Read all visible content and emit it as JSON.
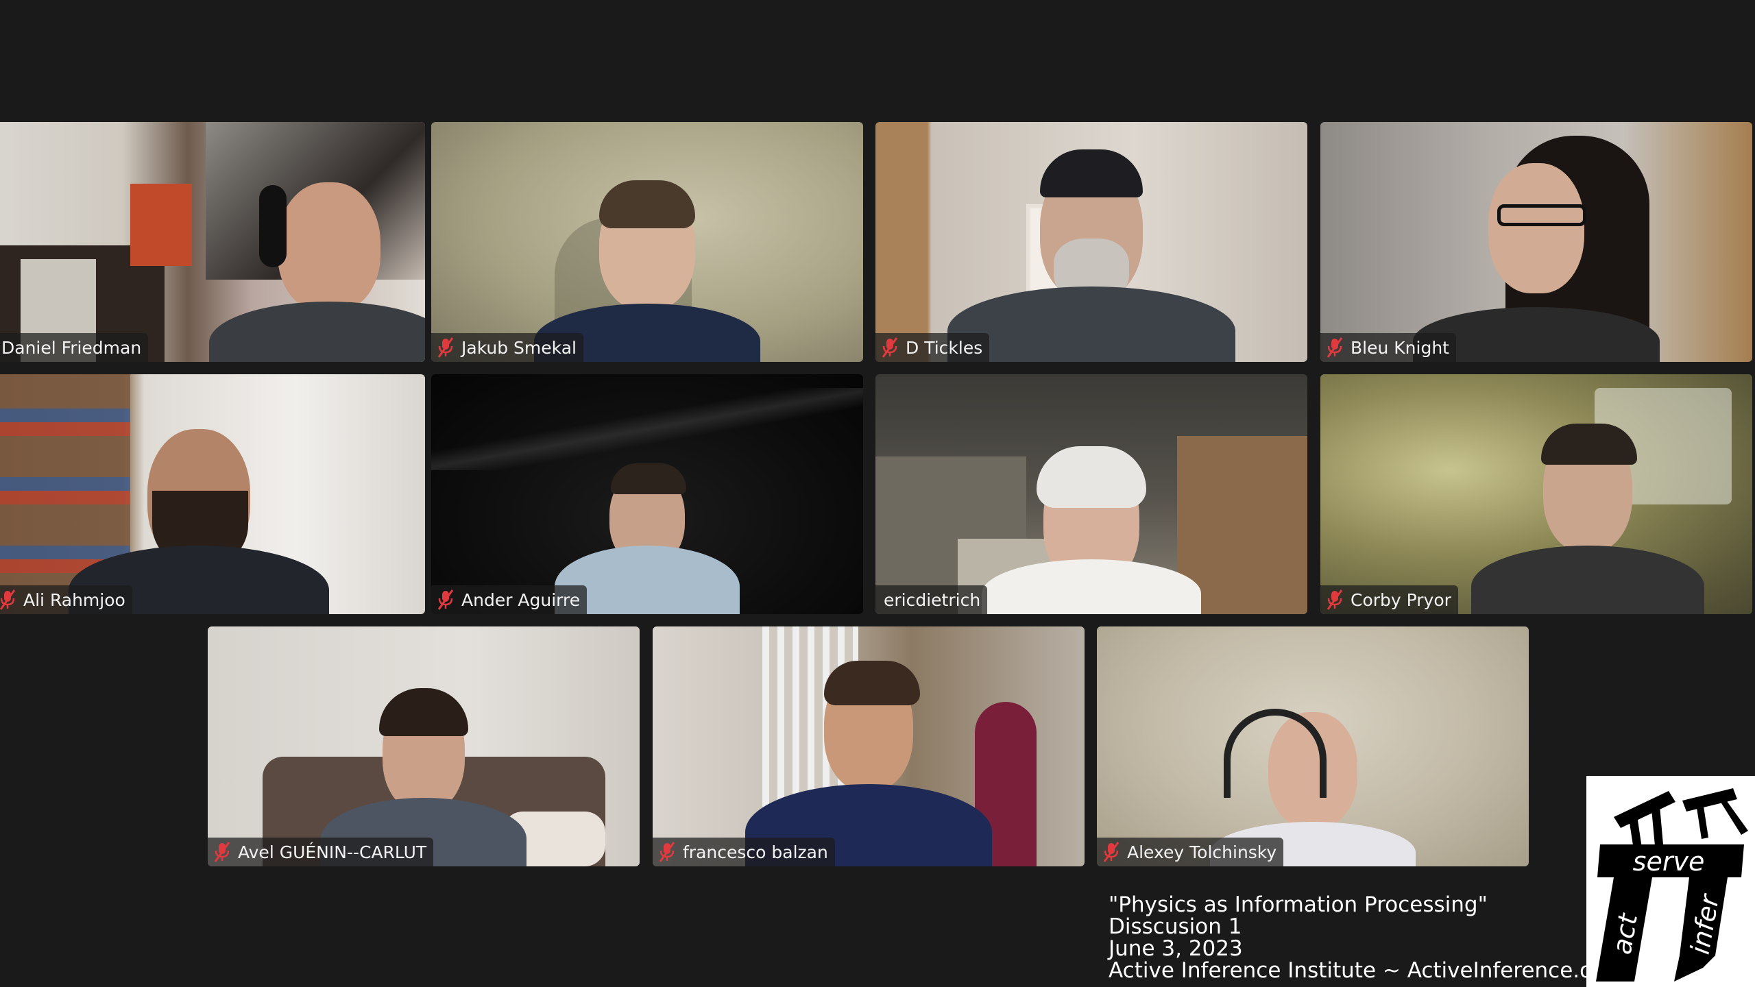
{
  "participants": [
    {
      "name": "Daniel Friedman",
      "muted": false,
      "speaking": false
    },
    {
      "name": "Jakub Smekal",
      "muted": true,
      "speaking": false
    },
    {
      "name": "D Tickles",
      "muted": true,
      "speaking": false
    },
    {
      "name": "Bleu Knight",
      "muted": true,
      "speaking": false
    },
    {
      "name": "Ali Rahmjoo",
      "muted": true,
      "speaking": false
    },
    {
      "name": "Ander Aguirre",
      "muted": true,
      "speaking": false
    },
    {
      "name": "ericdietrich",
      "muted": false,
      "speaking": false
    },
    {
      "name": "Corby Pryor",
      "muted": true,
      "speaking": true
    },
    {
      "name": "Avel GUÉNIN--CARLUT",
      "muted": true,
      "speaking": false
    },
    {
      "name": "francesco balzan",
      "muted": true,
      "speaking": false
    },
    {
      "name": "Alexey Tolchinsky",
      "muted": true,
      "speaking": false
    }
  ],
  "caption": {
    "line1": "\"Physics as Information Processing\"",
    "line2": "Disscusion 1",
    "line3": "June 3, 2023",
    "line4": "Active Inference Institute ~ ActiveInference.org"
  },
  "logo": {
    "word_serve": "serve",
    "word_act": "act",
    "word_infer": "infer"
  },
  "colors": {
    "background": "#1a1a1a",
    "speaking_border": "#3cd16a",
    "muted_icon": "#e0393e"
  },
  "icons": {
    "muted": "microphone-muted-icon"
  }
}
